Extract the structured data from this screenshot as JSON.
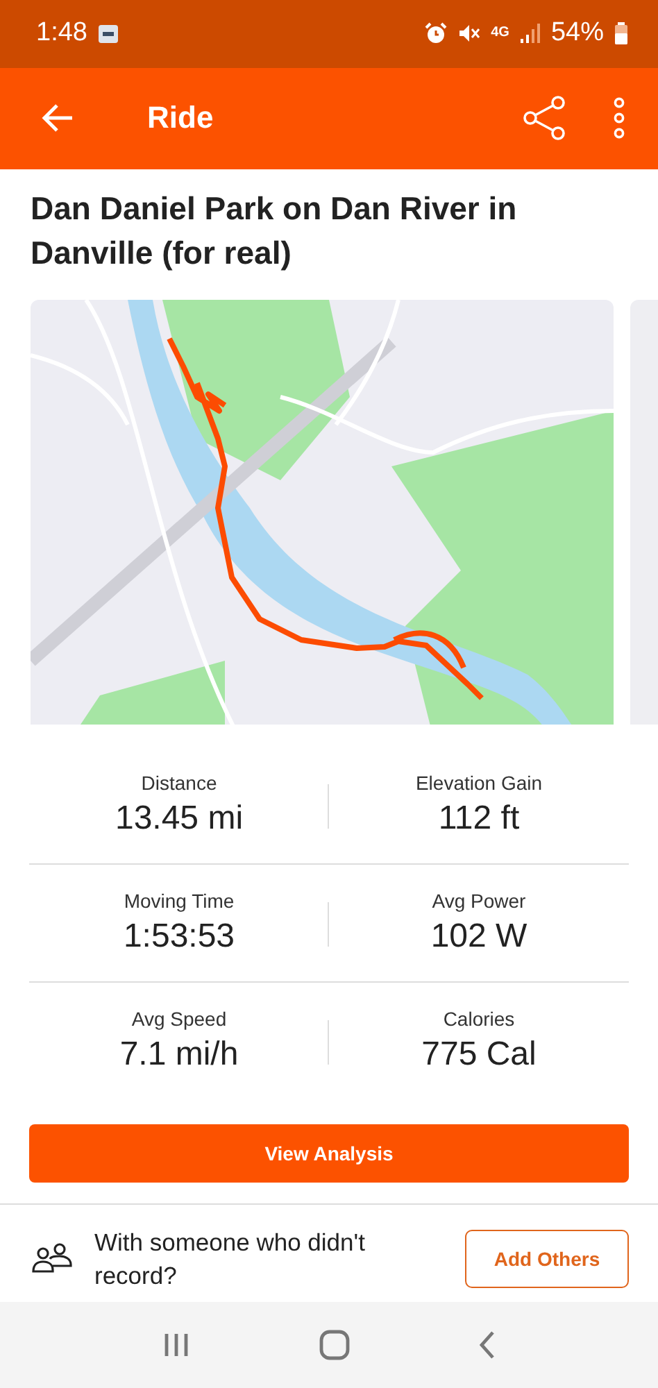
{
  "status_bar": {
    "time": "1:48",
    "network": "4G",
    "battery": "54%"
  },
  "app_bar": {
    "title": "Ride"
  },
  "activity": {
    "title": "Dan Daniel Park on Dan River in Danville (for real)"
  },
  "stats": [
    {
      "label": "Distance",
      "value": "13.45 mi"
    },
    {
      "label": "Elevation Gain",
      "value": "112 ft"
    },
    {
      "label": "Moving Time",
      "value": "1:53:53"
    },
    {
      "label": "Avg Power",
      "value": "102 W"
    },
    {
      "label": "Avg Speed",
      "value": "7.1 mi/h"
    },
    {
      "label": "Calories",
      "value": "775 Cal"
    }
  ],
  "analysis_button": "View Analysis",
  "add_others": {
    "prompt": "With someone who didn't record?",
    "button": "Add Others"
  }
}
